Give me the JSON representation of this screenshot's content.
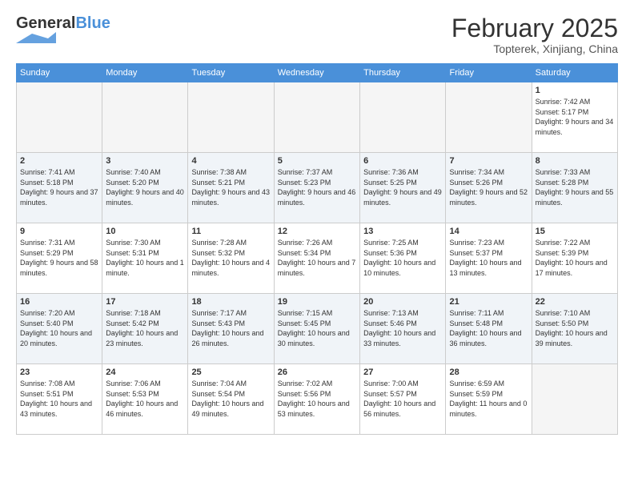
{
  "header": {
    "logo_general": "General",
    "logo_blue": "Blue",
    "title": "February 2025",
    "location": "Topterek, Xinjiang, China"
  },
  "days_of_week": [
    "Sunday",
    "Monday",
    "Tuesday",
    "Wednesday",
    "Thursday",
    "Friday",
    "Saturday"
  ],
  "weeks": [
    {
      "shaded": false,
      "days": [
        {
          "num": "",
          "info": ""
        },
        {
          "num": "",
          "info": ""
        },
        {
          "num": "",
          "info": ""
        },
        {
          "num": "",
          "info": ""
        },
        {
          "num": "",
          "info": ""
        },
        {
          "num": "",
          "info": ""
        },
        {
          "num": "1",
          "info": "Sunrise: 7:42 AM\nSunset: 5:17 PM\nDaylight: 9 hours and 34 minutes."
        }
      ]
    },
    {
      "shaded": true,
      "days": [
        {
          "num": "2",
          "info": "Sunrise: 7:41 AM\nSunset: 5:18 PM\nDaylight: 9 hours and 37 minutes."
        },
        {
          "num": "3",
          "info": "Sunrise: 7:40 AM\nSunset: 5:20 PM\nDaylight: 9 hours and 40 minutes."
        },
        {
          "num": "4",
          "info": "Sunrise: 7:38 AM\nSunset: 5:21 PM\nDaylight: 9 hours and 43 minutes."
        },
        {
          "num": "5",
          "info": "Sunrise: 7:37 AM\nSunset: 5:23 PM\nDaylight: 9 hours and 46 minutes."
        },
        {
          "num": "6",
          "info": "Sunrise: 7:36 AM\nSunset: 5:25 PM\nDaylight: 9 hours and 49 minutes."
        },
        {
          "num": "7",
          "info": "Sunrise: 7:34 AM\nSunset: 5:26 PM\nDaylight: 9 hours and 52 minutes."
        },
        {
          "num": "8",
          "info": "Sunrise: 7:33 AM\nSunset: 5:28 PM\nDaylight: 9 hours and 55 minutes."
        }
      ]
    },
    {
      "shaded": false,
      "days": [
        {
          "num": "9",
          "info": "Sunrise: 7:31 AM\nSunset: 5:29 PM\nDaylight: 9 hours and 58 minutes."
        },
        {
          "num": "10",
          "info": "Sunrise: 7:30 AM\nSunset: 5:31 PM\nDaylight: 10 hours and 1 minute."
        },
        {
          "num": "11",
          "info": "Sunrise: 7:28 AM\nSunset: 5:32 PM\nDaylight: 10 hours and 4 minutes."
        },
        {
          "num": "12",
          "info": "Sunrise: 7:26 AM\nSunset: 5:34 PM\nDaylight: 10 hours and 7 minutes."
        },
        {
          "num": "13",
          "info": "Sunrise: 7:25 AM\nSunset: 5:36 PM\nDaylight: 10 hours and 10 minutes."
        },
        {
          "num": "14",
          "info": "Sunrise: 7:23 AM\nSunset: 5:37 PM\nDaylight: 10 hours and 13 minutes."
        },
        {
          "num": "15",
          "info": "Sunrise: 7:22 AM\nSunset: 5:39 PM\nDaylight: 10 hours and 17 minutes."
        }
      ]
    },
    {
      "shaded": true,
      "days": [
        {
          "num": "16",
          "info": "Sunrise: 7:20 AM\nSunset: 5:40 PM\nDaylight: 10 hours and 20 minutes."
        },
        {
          "num": "17",
          "info": "Sunrise: 7:18 AM\nSunset: 5:42 PM\nDaylight: 10 hours and 23 minutes."
        },
        {
          "num": "18",
          "info": "Sunrise: 7:17 AM\nSunset: 5:43 PM\nDaylight: 10 hours and 26 minutes."
        },
        {
          "num": "19",
          "info": "Sunrise: 7:15 AM\nSunset: 5:45 PM\nDaylight: 10 hours and 30 minutes."
        },
        {
          "num": "20",
          "info": "Sunrise: 7:13 AM\nSunset: 5:46 PM\nDaylight: 10 hours and 33 minutes."
        },
        {
          "num": "21",
          "info": "Sunrise: 7:11 AM\nSunset: 5:48 PM\nDaylight: 10 hours and 36 minutes."
        },
        {
          "num": "22",
          "info": "Sunrise: 7:10 AM\nSunset: 5:50 PM\nDaylight: 10 hours and 39 minutes."
        }
      ]
    },
    {
      "shaded": false,
      "days": [
        {
          "num": "23",
          "info": "Sunrise: 7:08 AM\nSunset: 5:51 PM\nDaylight: 10 hours and 43 minutes."
        },
        {
          "num": "24",
          "info": "Sunrise: 7:06 AM\nSunset: 5:53 PM\nDaylight: 10 hours and 46 minutes."
        },
        {
          "num": "25",
          "info": "Sunrise: 7:04 AM\nSunset: 5:54 PM\nDaylight: 10 hours and 49 minutes."
        },
        {
          "num": "26",
          "info": "Sunrise: 7:02 AM\nSunset: 5:56 PM\nDaylight: 10 hours and 53 minutes."
        },
        {
          "num": "27",
          "info": "Sunrise: 7:00 AM\nSunset: 5:57 PM\nDaylight: 10 hours and 56 minutes."
        },
        {
          "num": "28",
          "info": "Sunrise: 6:59 AM\nSunset: 5:59 PM\nDaylight: 11 hours and 0 minutes."
        },
        {
          "num": "",
          "info": ""
        }
      ]
    }
  ]
}
